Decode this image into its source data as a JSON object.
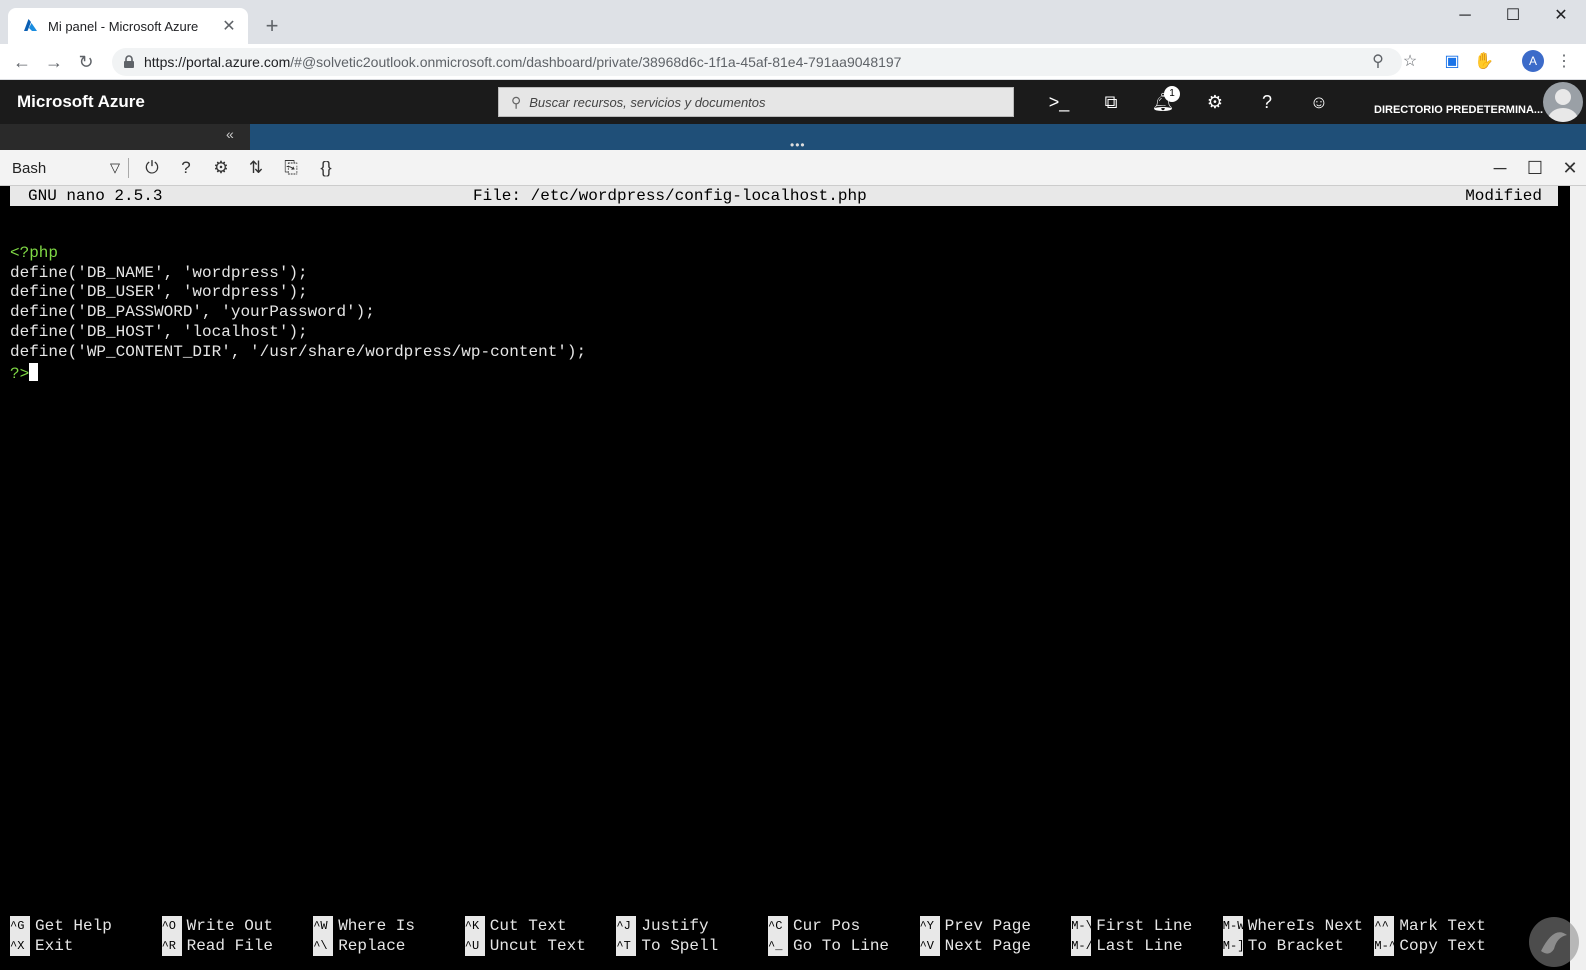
{
  "browser": {
    "tab_title": "Mi panel - Microsoft Azure",
    "url_host": "https://portal.azure.com",
    "url_rest": "/#@solvetic2outlook.onmicrosoft.com/dashboard/private/38968d6c-1f1a-45af-81e4-791aa9048197"
  },
  "azure": {
    "brand": "Microsoft Azure",
    "search_placeholder": "Buscar recursos, servicios y documentos",
    "notification_count": "1",
    "directory": "DIRECTORIO PREDETERMINA..."
  },
  "shell": {
    "selected": "Bash"
  },
  "nano": {
    "version": "GNU nano 2.5.3",
    "file": "File: /etc/wordpress/config-localhost.php",
    "status": "Modified",
    "lines": [
      "<?php",
      "define('DB_NAME', 'wordpress');",
      "define('DB_USER', 'wordpress');",
      "define('DB_PASSWORD', 'yourPassword');",
      "define('DB_HOST', 'localhost');",
      "define('WP_CONTENT_DIR', '/usr/share/wordpress/wp-content');",
      "?>"
    ],
    "shortcuts": [
      {
        "key1": "^G",
        "label1": "Get Help",
        "key2": "^X",
        "label2": "Exit"
      },
      {
        "key1": "^O",
        "label1": "Write Out",
        "key2": "^R",
        "label2": "Read File"
      },
      {
        "key1": "^W",
        "label1": "Where Is",
        "key2": "^\\",
        "label2": "Replace"
      },
      {
        "key1": "^K",
        "label1": "Cut Text",
        "key2": "^U",
        "label2": "Uncut Text"
      },
      {
        "key1": "^J",
        "label1": "Justify",
        "key2": "^T",
        "label2": "To Spell"
      },
      {
        "key1": "^C",
        "label1": "Cur Pos",
        "key2": "^_",
        "label2": "Go To Line"
      },
      {
        "key1": "^Y",
        "label1": "Prev Page",
        "key2": "^V",
        "label2": "Next Page"
      },
      {
        "key1": "M-\\",
        "label1": "First Line",
        "key2": "M-/",
        "label2": "Last Line"
      },
      {
        "key1": "M-W",
        "label1": "WhereIs Next",
        "key2": "M-]",
        "label2": "To Bracket"
      },
      {
        "key1": "^^",
        "label1": "Mark Text",
        "key2": "M-^",
        "label2": "Copy Text"
      }
    ]
  },
  "colors": {
    "php_tag": "#7fd845",
    "azure_header": "#1b1b1b",
    "nano_bar": "#e8e8e8"
  }
}
